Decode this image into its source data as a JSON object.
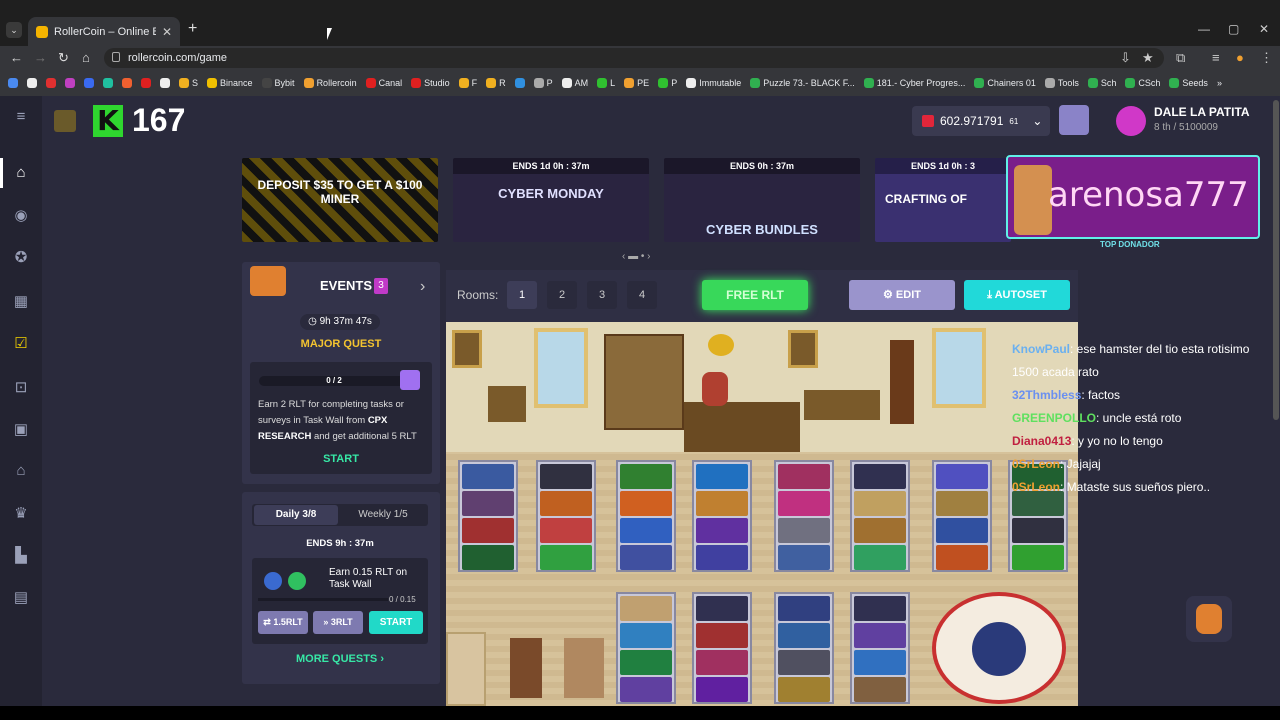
{
  "browser": {
    "tab_title": "RollerCoin – Online Bitcoin Mi…",
    "url": "rollercoin.com/game",
    "bookmarks": [
      "S",
      "Binance",
      "Bybit",
      "Rollercoin",
      "Canal",
      "Studio",
      "F",
      "R",
      "P",
      "AM",
      "L",
      "PE",
      "P",
      "Immutable",
      "Puzzle 73.- BLACK F...",
      "181.- Cyber Progres...",
      "Chainers 01",
      "Tools",
      "Sch",
      "CSch",
      "Seeds"
    ]
  },
  "header": {
    "level": "167",
    "balance": "602.97179161",
    "balance_suffix": "61",
    "balance_main": "602.971791",
    "username": "DALE LA PATITA",
    "rank": "8 th / 5100009"
  },
  "banners": [
    {
      "ends": "",
      "title": "DEPOSIT $35 TO GET A $100 MINER"
    },
    {
      "ends": "ENDS  1d 0h : 37m",
      "title": "CYBER MONDAY"
    },
    {
      "ends": "ENDS  0h : 37m",
      "title": "CYBER BUNDLES"
    },
    {
      "ends": "ENDS  1d 0h : 3",
      "title": "CRAFTING OF"
    }
  ],
  "streamer": {
    "name": "arenosa777",
    "label": "TOP DONADOR"
  },
  "events": {
    "title": "EVENTS",
    "count": "3",
    "timer": "9h 37m 47s",
    "quest_title": "MAJOR QUEST",
    "progress": "0 / 2",
    "desc_1": "Earn 2 RLT for completing tasks or surveys in Task Wall from ",
    "desc_bold": "CPX RESEARCH",
    "desc_2": " and get additional 5 RLT",
    "start": "START"
  },
  "quests": {
    "daily": "Daily  3/8",
    "weekly": "Weekly  1/5",
    "ends": "ENDS  9h : 37m",
    "task": "Earn 0.15 RLT on Task Wall",
    "task_prog": "0 / 0.15",
    "btn1": "1.5RLT",
    "btn2": "3RLT",
    "btn_start": "START",
    "more": "MORE QUESTS"
  },
  "rooms": {
    "label": "Rooms:",
    "numbers": [
      "1",
      "2",
      "3",
      "4"
    ],
    "free": "FREE RLT",
    "edit": "EDIT",
    "autoset": "AUTOSET"
  },
  "chat": [
    {
      "user": "KnowPaul",
      "msg": ": ese hamster del tio esta rotisimo 1500 acada rato",
      "color": "#6ab0f0"
    },
    {
      "user": "32Thmbless",
      "msg": ": factos",
      "color": "#6a90f0"
    },
    {
      "user": "GREENPOLLO",
      "msg": ": uncle está roto",
      "color": "#5fe05f"
    },
    {
      "user": "Diana0413",
      "msg": ": y yo no lo tengo",
      "color": "#c02040"
    },
    {
      "user": "0SrLeon",
      "msg": ": Jajajaj",
      "color": "#f0a030"
    },
    {
      "user": "0SrLeon",
      "msg": ": Mataste sus sueños piero..",
      "color": "#f0a030"
    }
  ]
}
